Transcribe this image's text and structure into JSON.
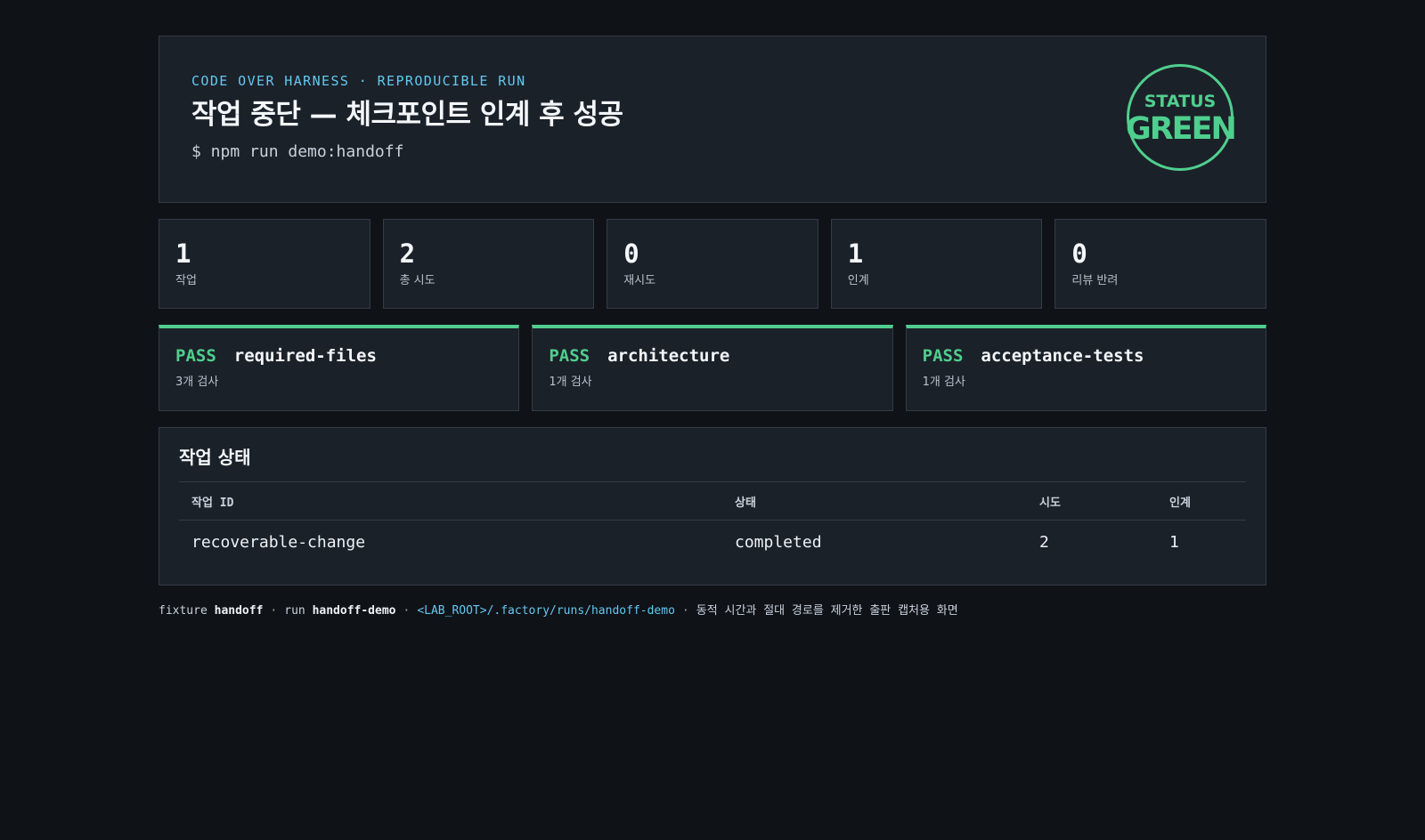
{
  "header": {
    "kicker": "CODE OVER HARNESS · REPRODUCIBLE RUN",
    "title": "작업 중단 — 체크포인트 인계 후 성공",
    "command": "$ npm run demo:handoff",
    "status_label": "STATUS",
    "status_value": "GREEN"
  },
  "stats": [
    {
      "value": "1",
      "label": "작업"
    },
    {
      "value": "2",
      "label": "총 시도"
    },
    {
      "value": "0",
      "label": "재시도"
    },
    {
      "value": "1",
      "label": "인계"
    },
    {
      "value": "0",
      "label": "리뷰 반려"
    }
  ],
  "checks": [
    {
      "result": "PASS",
      "name": "required-files",
      "detail": "3개 검사"
    },
    {
      "result": "PASS",
      "name": "architecture",
      "detail": "1개 검사"
    },
    {
      "result": "PASS",
      "name": "acceptance-tests",
      "detail": "1개 검사"
    }
  ],
  "tasks": {
    "title": "작업 상태",
    "columns": [
      "작업 ID",
      "상태",
      "시도",
      "인계"
    ],
    "rows": [
      [
        "recoverable-change",
        "completed",
        "2",
        "1"
      ]
    ]
  },
  "footer": {
    "fixture_prefix": "fixture",
    "fixture": "handoff",
    "run_prefix": "run",
    "run": "handoff-demo",
    "path": "<LAB_ROOT>/.factory/runs/handoff-demo",
    "note": "동적 시간과 절대 경로를 제거한 출판 캡처용 화면",
    "separator": "·"
  },
  "colors": {
    "background": "#0f1217",
    "panel": "#1b2129",
    "accent_green": "#4fcf8e",
    "accent_blue": "#64c8f0"
  }
}
